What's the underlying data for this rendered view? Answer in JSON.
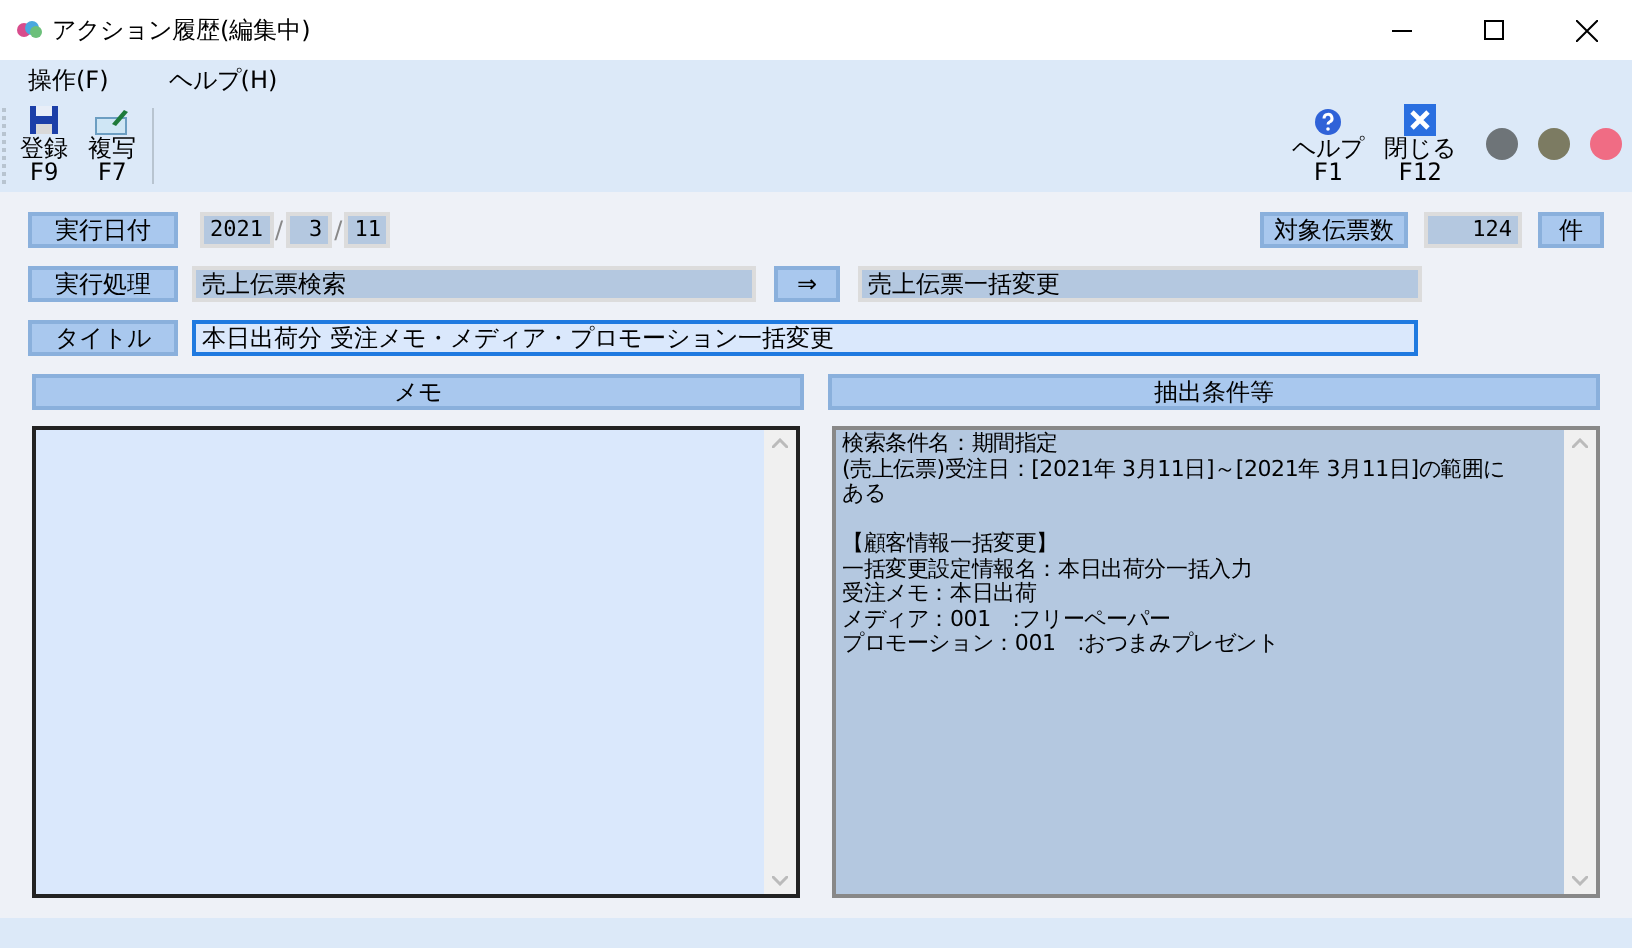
{
  "window": {
    "title": "アクション履歴(編集中)"
  },
  "menu": [
    "操作(F)",
    "ヘルプ(H)"
  ],
  "toolbar_left": [
    {
      "kind": "save",
      "label": "登録",
      "key": "F9"
    },
    {
      "kind": "copy",
      "label": "複写",
      "key": "F7"
    }
  ],
  "toolbar_right": [
    {
      "kind": "help",
      "label": "ヘルプ",
      "key": "F1"
    },
    {
      "kind": "close",
      "label": "閉じる",
      "key": "F12"
    }
  ],
  "indicators": [
    {
      "color": "#6e7478"
    },
    {
      "color": "#7c7b62"
    },
    {
      "color": "#f06c84"
    }
  ],
  "date": {
    "label": "実行日付",
    "year": "2021",
    "sep1": "/",
    "month": "3",
    "sep2": "/",
    "day": "11"
  },
  "count": {
    "label": "対象伝票数",
    "value": "124",
    "unit": "件"
  },
  "process": {
    "label": "実行処理",
    "from": "売上伝票検索",
    "arrow": "⇒",
    "to": "売上伝票一括変更"
  },
  "title_field": {
    "label": "タイトル",
    "value": "本日出荷分 受注メモ・メディア・プロモーション一括変更"
  },
  "memo": {
    "header": "メモ"
  },
  "conditions": {
    "header": "抽出条件等",
    "blocks": [
      [
        "検索条件名：期間指定",
        "(売上伝票)受注日：[2021年 3月11日]～[2021年 3月11日]の範囲に",
        "ある"
      ],
      [
        "【顧客情報一括変更】",
        "一括変更設定情報名：本日出荷分一括入力",
        "受注メモ：本日出荷",
        "メディア：001　:フリーペーパー",
        "プロモーション：001　:おつまみプレゼント"
      ]
    ]
  }
}
